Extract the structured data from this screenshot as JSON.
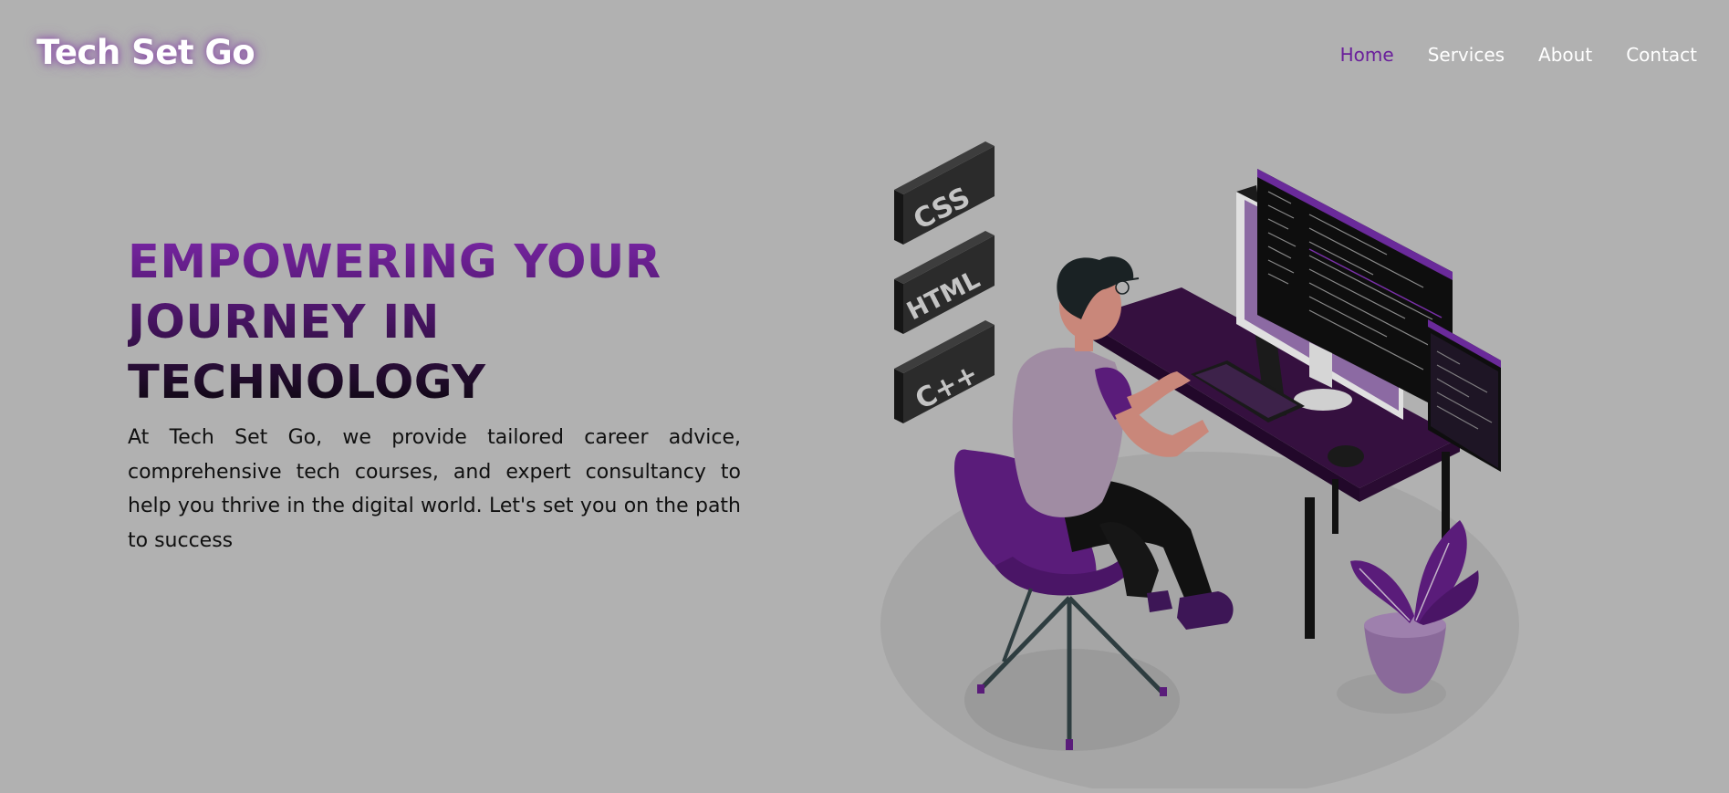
{
  "header": {
    "logo": "Tech Set Go",
    "nav": [
      {
        "label": "Home",
        "active": true
      },
      {
        "label": "Services",
        "active": false
      },
      {
        "label": "About",
        "active": false
      },
      {
        "label": "Contact",
        "active": false
      }
    ]
  },
  "hero": {
    "headline_lines": [
      "EMPOWERING YOUR",
      "JOURNEY IN",
      "TECHNOLOGY"
    ],
    "description": "At Tech Set Go, we provide tailored career advice, comprehensive tech courses, and expert consultancy to help you thrive in the digital world. Let's set you on the path to success"
  },
  "illustration": {
    "code_blocks": [
      "CSS",
      "HTML",
      "C++"
    ]
  },
  "colors": {
    "background": "#b1b1b1",
    "accent_purple": "#6a1f9b",
    "headline_top": "#7a26a6",
    "headline_bottom": "#15091b"
  }
}
